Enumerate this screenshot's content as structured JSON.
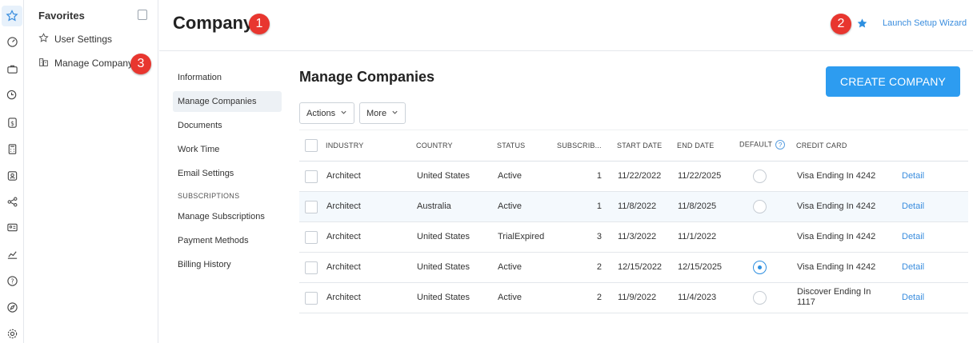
{
  "favorites": {
    "title": "Favorites",
    "items": [
      {
        "label": "User Settings",
        "icon": "star-outline-icon"
      },
      {
        "label": "Manage Company",
        "icon": "building-icon"
      }
    ]
  },
  "header": {
    "title": "Company",
    "launch_link": "Launch Setup Wizard"
  },
  "badges": [
    "1",
    "2",
    "3"
  ],
  "subnav": {
    "items": [
      "Information",
      "Manage Companies",
      "Documents",
      "Work Time",
      "Email Settings"
    ],
    "active": "Manage Companies",
    "section_label": "SUBSCRIPTIONS",
    "section_items": [
      "Manage Subscriptions",
      "Payment Methods",
      "Billing History"
    ]
  },
  "main": {
    "title": "Manage Companies",
    "create_label": "CREATE COMPANY",
    "actions_label": "Actions",
    "more_label": "More"
  },
  "table": {
    "headers": [
      "INDUSTRY",
      "COUNTRY",
      "STATUS",
      "SUBSCRIB...",
      "START DATE",
      "END DATE",
      "DEFAULT",
      "CREDIT CARD"
    ],
    "help_glyph": "?",
    "detail_label": "Detail",
    "rows": [
      {
        "industry": "Architect",
        "country": "United States",
        "status": "Active",
        "subs": "1",
        "start": "11/22/2022",
        "end": "11/22/2025",
        "default": "off",
        "card": "Visa Ending In 4242"
      },
      {
        "industry": "Architect",
        "country": "Australia",
        "status": "Active",
        "subs": "1",
        "start": "11/8/2022",
        "end": "11/8/2025",
        "default": "off",
        "card": "Visa Ending In 4242"
      },
      {
        "industry": "Architect",
        "country": "United States",
        "status": "TrialExpired",
        "subs": "3",
        "start": "11/3/2022",
        "end": "11/1/2022",
        "default": "none",
        "card": "Visa Ending In 4242"
      },
      {
        "industry": "Architect",
        "country": "United States",
        "status": "Active",
        "subs": "2",
        "start": "12/15/2022",
        "end": "12/15/2025",
        "default": "on",
        "card": "Visa Ending In 4242"
      },
      {
        "industry": "Architect",
        "country": "United States",
        "status": "Active",
        "subs": "2",
        "start": "11/9/2022",
        "end": "11/4/2023",
        "default": "off",
        "card_line1": "Discover Ending In",
        "card_line2": "1117"
      }
    ]
  },
  "colors": {
    "accent": "#2d9cf0",
    "link": "#3a8dde",
    "badge": "#e8362f"
  },
  "rail_icons": [
    "star-icon",
    "dashboard-icon",
    "briefcase-icon",
    "clock-dollar-icon",
    "dollar-icon",
    "calculator-icon",
    "user-badge-icon",
    "network-icon",
    "id-card-icon",
    "chart-icon",
    "help-icon",
    "compass-icon",
    "gear-icon"
  ]
}
